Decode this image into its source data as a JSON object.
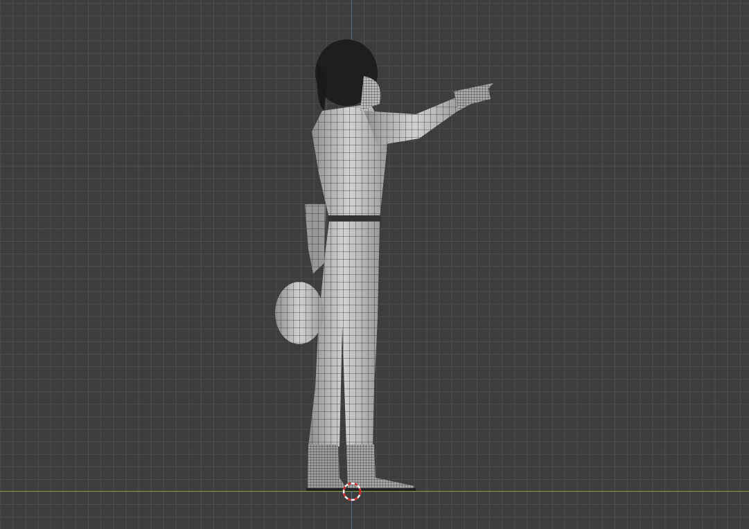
{
  "viewport": {
    "mode": "wireframe-overlay",
    "view": "side-orthographic",
    "colors": {
      "background": "#3d3d3d",
      "grid": "#4d4d4d",
      "x_axis": "#7a9a3a",
      "z_axis": "#4a6c9a",
      "mesh_fill": "#bdbdbd",
      "wire": "#2a2a2a",
      "cursor_red": "#d42a2a"
    },
    "icons": [
      "3d-cursor-icon"
    ]
  }
}
